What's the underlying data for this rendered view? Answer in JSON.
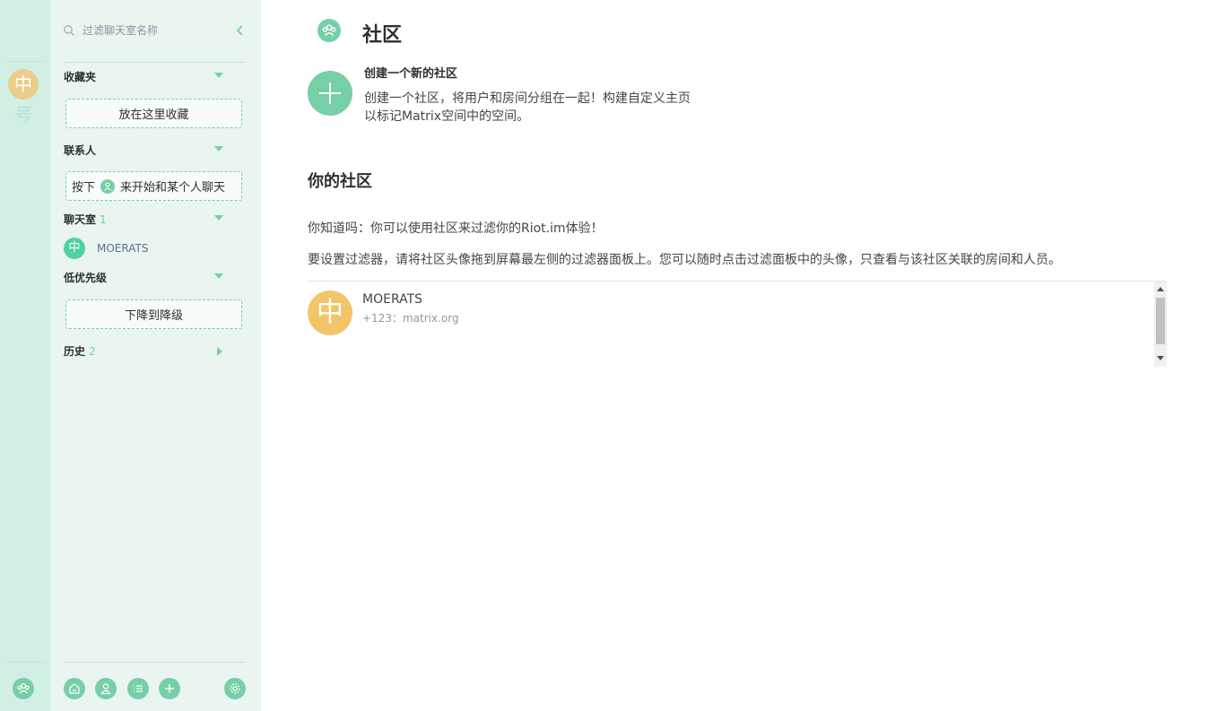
{
  "theme": {
    "accent": "#76cfa6",
    "sidebar_bg": "#eaf5f0",
    "leftpanel_bg": "#d2efe4",
    "group_avatar_bg": "#f2c569"
  },
  "leftpanel": {
    "group_tile_char": "中",
    "group_tile_char2": "号",
    "bottom_icon": "groups-icon"
  },
  "sidebar": {
    "search": {
      "placeholder": "过滤聊天室名称",
      "icon": "search-icon"
    },
    "sections": {
      "favourites": {
        "label": "收藏夹",
        "drop_label": "放在这里收藏"
      },
      "people": {
        "label": "联系人",
        "hint_before": "按下",
        "hint_after": "来开始和某个人聊天"
      },
      "rooms": {
        "label": "聊天室",
        "count": "1",
        "items": [
          {
            "avatar_char": "中",
            "name": "MOERATS"
          }
        ]
      },
      "low_priority": {
        "label": "低优先级",
        "drop_label": "下降到降级"
      },
      "history": {
        "label": "历史",
        "count": "2"
      }
    },
    "bottom_buttons": [
      "home-icon",
      "person-icon",
      "room-directory-icon",
      "create-room-icon",
      "settings-icon"
    ]
  },
  "main": {
    "title": "社区",
    "create": {
      "title": "创建一个新的社区",
      "desc_line1": "创建一个社区，将用户和房间分组在一起！构建自定义主页",
      "desc_line2": "以标记Matrix空间中的空间。"
    },
    "your_communities": {
      "title": "你的社区",
      "tip1": "你知道吗：你可以使用社区来过滤你的Riot.im体验！",
      "tip2": "要设置过滤器，请将社区头像拖到屏幕最左侧的过滤器面板上。您可以随时点击过滤面板中的头像，只查看与该社区关联的房间和人员。",
      "groups": [
        {
          "avatar_char": "中",
          "name": "MOERATS",
          "id": "+123：matrix.org"
        }
      ]
    }
  }
}
